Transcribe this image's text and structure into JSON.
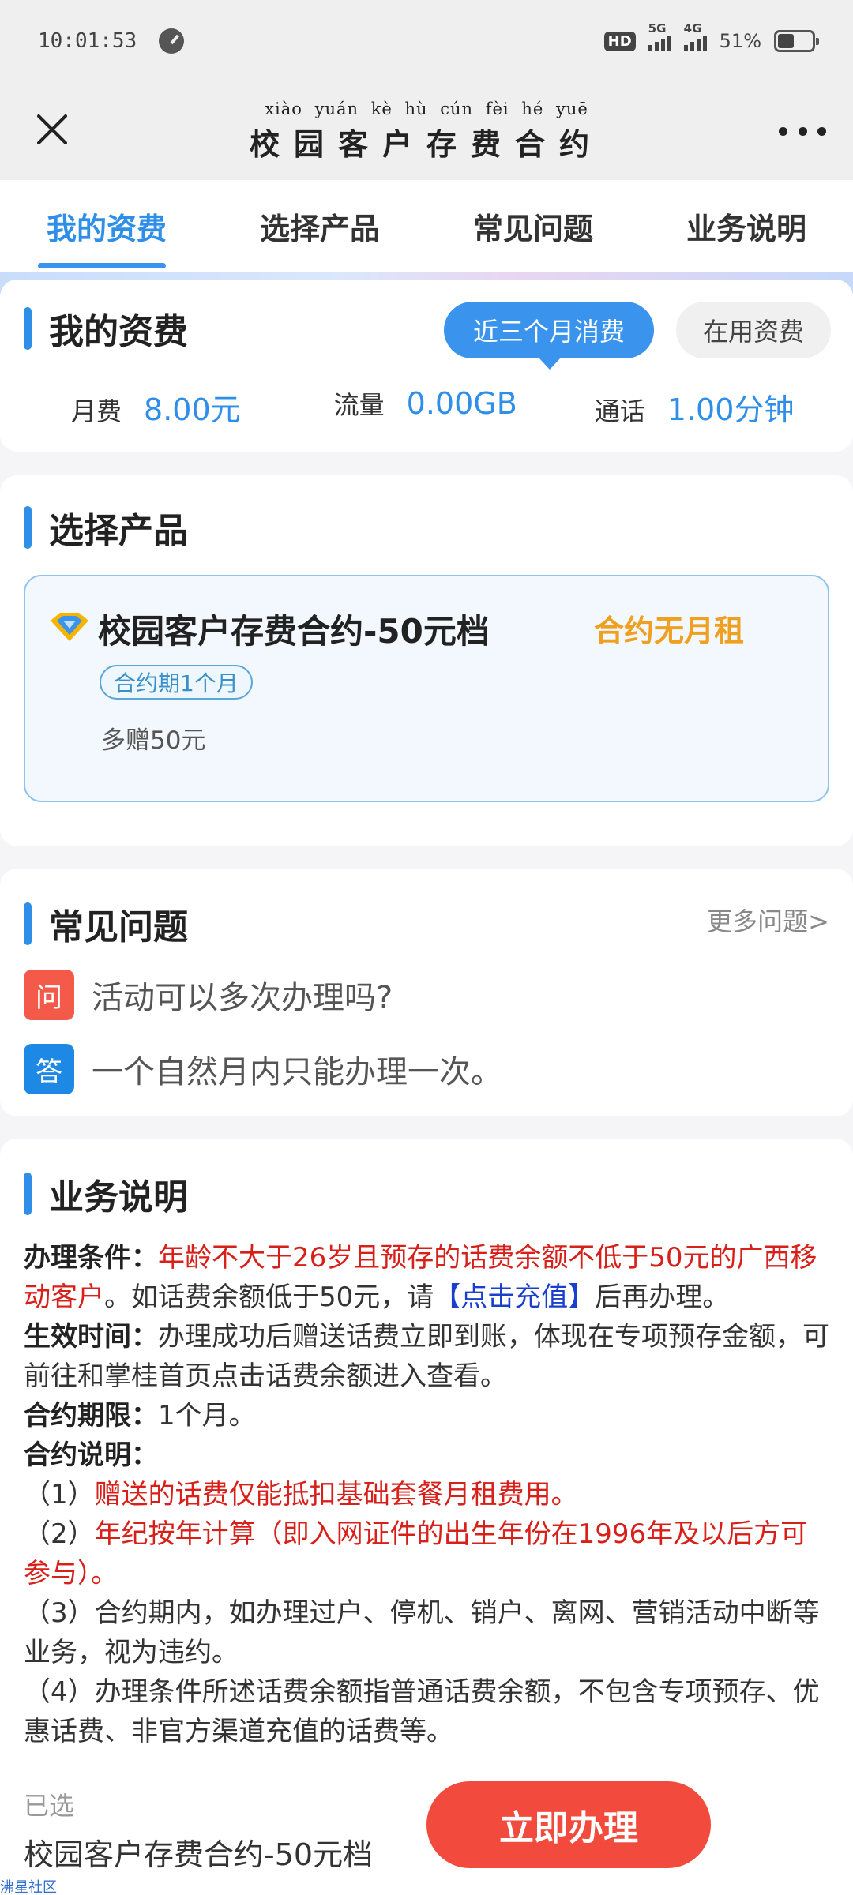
{
  "status_bar": {
    "time": "10:01:53",
    "hd": "HD",
    "sim1_network": "5G",
    "sim2_network": "4G",
    "battery": "51%"
  },
  "titlebar": {
    "pinyin": "xiào yuán kè hù cún fèi hé yuē",
    "title": "校园客户存费合约"
  },
  "tabs": [
    {
      "label": "我的资费",
      "active": true
    },
    {
      "label": "选择产品",
      "active": false
    },
    {
      "label": "常见问题",
      "active": false
    },
    {
      "label": "业务说明",
      "active": false
    }
  ],
  "my_fee": {
    "title": "我的资费",
    "pill_active": "近三个月消费",
    "pill_plain": "在用资费",
    "stats": [
      {
        "label": "月费",
        "value": "8.00元"
      },
      {
        "label": "流量",
        "value": "0.00GB"
      },
      {
        "label": "通话",
        "value": "1.00分钟"
      }
    ]
  },
  "product": {
    "title": "选择产品",
    "name": "校园客户存费合约-50元档",
    "tag": "合约无月租",
    "badge": "合约期1个月",
    "desc": "多赠50元"
  },
  "faq": {
    "title": "常见问题",
    "more": "更多问题>",
    "q_badge": "问",
    "question": "活动可以多次办理吗?",
    "a_badge": "答",
    "answer": "一个自然月内只能办理一次。"
  },
  "description": {
    "title": "业务说明",
    "cond_label": "办理条件：",
    "cond_red": "年龄不大于26岁且预存的话费余额不低于50元的广西移动客户",
    "cond_mid": "。如话费余额低于50元，请",
    "cond_link": "【点击充值】",
    "cond_end": "后再办理。",
    "eff_label": "生效时间：",
    "eff_text": "办理成功后赠送话费立即到账，体现在专项预存金额，可前往和掌桂首页点击话费余额进入查看。",
    "term_label": "合约期限：",
    "term_text": "1个月。",
    "note_label": "合约说明：",
    "note1_num": "（1）",
    "note1_text": "赠送的话费仅能抵扣基础套餐月租费用。",
    "note2_num": "（2）",
    "note2_text": "年纪按年计算（即入网证件的出生年份在1996年及以后方可参与）。",
    "note3": "（3）合约期内，如办理过户、停机、销户、离网、营销活动中断等业务，视为违约。",
    "note4": "（4）办理条件所述话费余额指普通话费余额，不包含专项预存、优惠话费、非官方渠道充值的话费等。"
  },
  "bottom": {
    "selected_label": "已选",
    "selected_name": "校园客户存费合约-50元档",
    "submit": "立即办理"
  },
  "watermark": "沸星社区",
  "colors": {
    "accent_blue": "#2f8fe8",
    "orange_tag": "#f0a020",
    "red_text": "#d8201b",
    "submit_red": "#f24a3c",
    "question_badge": "#f35a4a",
    "answer_badge": "#1e88e5"
  }
}
